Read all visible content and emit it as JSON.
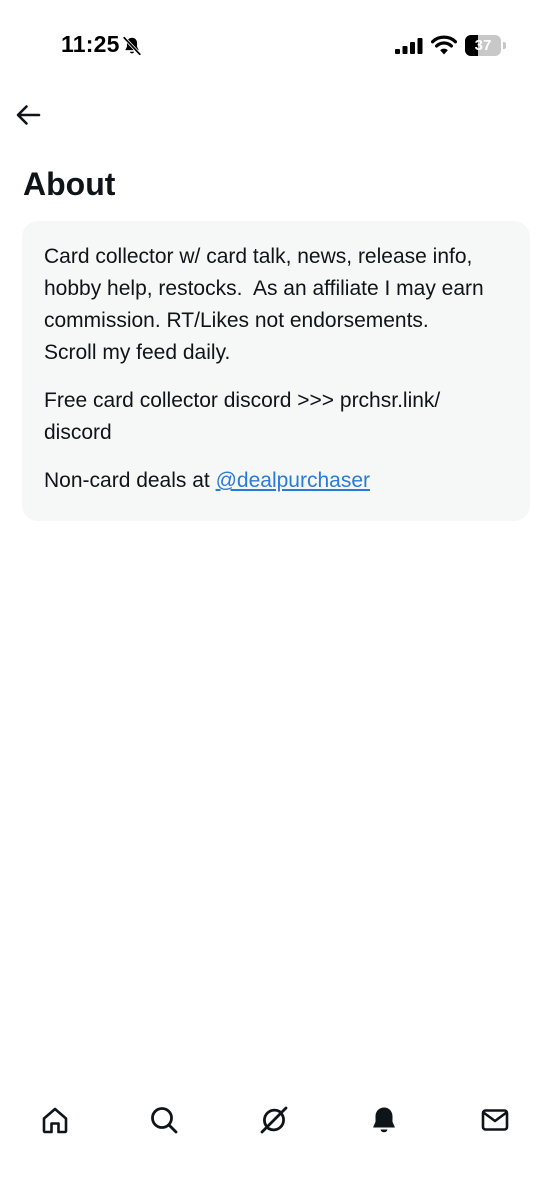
{
  "status_bar": {
    "time": "11:25",
    "battery_level": "37",
    "battery_fraction": 0.37,
    "icons": [
      "bell-muted-icon",
      "signal-icon",
      "wifi-icon",
      "battery-icon"
    ]
  },
  "header": {
    "back_icon": "arrow-left-icon",
    "title": "About"
  },
  "about": {
    "paragraph_1": [
      "Card collector w/ card talk, news, release info,",
      "hobby help, restocks.  As an affiliate I may earn",
      "commission. RT/Likes not endorsements.",
      "Scroll my feed daily."
    ],
    "paragraph_2": [
      "Free card collector discord >>> prchsr.link/",
      "discord"
    ],
    "paragraph_3_prefix": "Non-card deals at ",
    "paragraph_3_link": "@dealpurchaser"
  },
  "bottom_nav": {
    "items": [
      {
        "icon": "home-icon"
      },
      {
        "icon": "search-icon"
      },
      {
        "icon": "grok-icon"
      },
      {
        "icon": "notifications-bell-icon"
      },
      {
        "icon": "messages-envelope-icon"
      }
    ]
  },
  "colors": {
    "text": "#0f1419",
    "card_background": "#f6f7f7",
    "link": "#2a7bd8"
  }
}
